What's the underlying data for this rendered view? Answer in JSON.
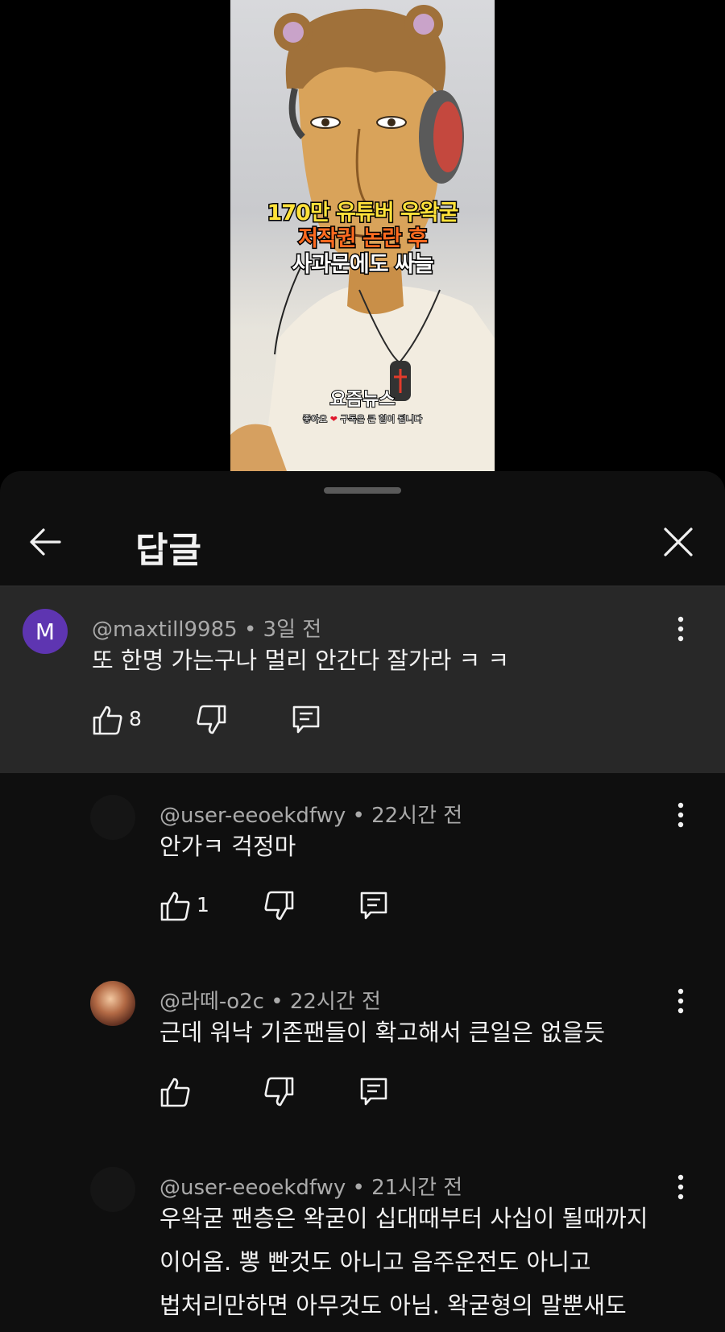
{
  "video": {
    "caption_line1": "170만 유튜버 우왁굳",
    "caption_line2": "저작권 논란 후",
    "caption_line3": "사과문에도 싸늘",
    "brand": "요즘뉴스",
    "tagline_before": "좋아요",
    "tagline_after": "구독은 큰 힘이 됩니다",
    "heart_glyph": "❤"
  },
  "header": {
    "title": "답글",
    "back_icon": "arrow-left-icon",
    "close_icon": "close-icon"
  },
  "parent_comment": {
    "avatar_letter": "M",
    "avatar_color": "#5e35b1",
    "author": "@maxtill9985",
    "time": "• 3일 전",
    "text": "또 한명 가는구나 멀리 안간다 잘가라 ㅋ ㅋ",
    "likes": "8"
  },
  "replies": [
    {
      "author": "@user-eeoekdfwy",
      "time": "• 22시간 전",
      "lines": [
        "안가ㅋ 걱정마"
      ],
      "likes": "1"
    },
    {
      "author": "@라떼-o2c",
      "time": "• 22시간 전",
      "lines": [
        "근데 워낙 기존팬들이 확고해서 큰일은 없을듯"
      ],
      "likes": ""
    },
    {
      "author": "@user-eeoekdfwy",
      "time": "• 21시간 전",
      "lines": [
        "우왁굳 팬층은 왁굳이 십대때부터 사십이 될때까지",
        "이어옴. 뽕 빤것도 아니고 음주운전도 아니고",
        "법처리만하면 아무것도 아님. 왁굳형의 말뿐새도"
      ],
      "likes": ""
    }
  ]
}
